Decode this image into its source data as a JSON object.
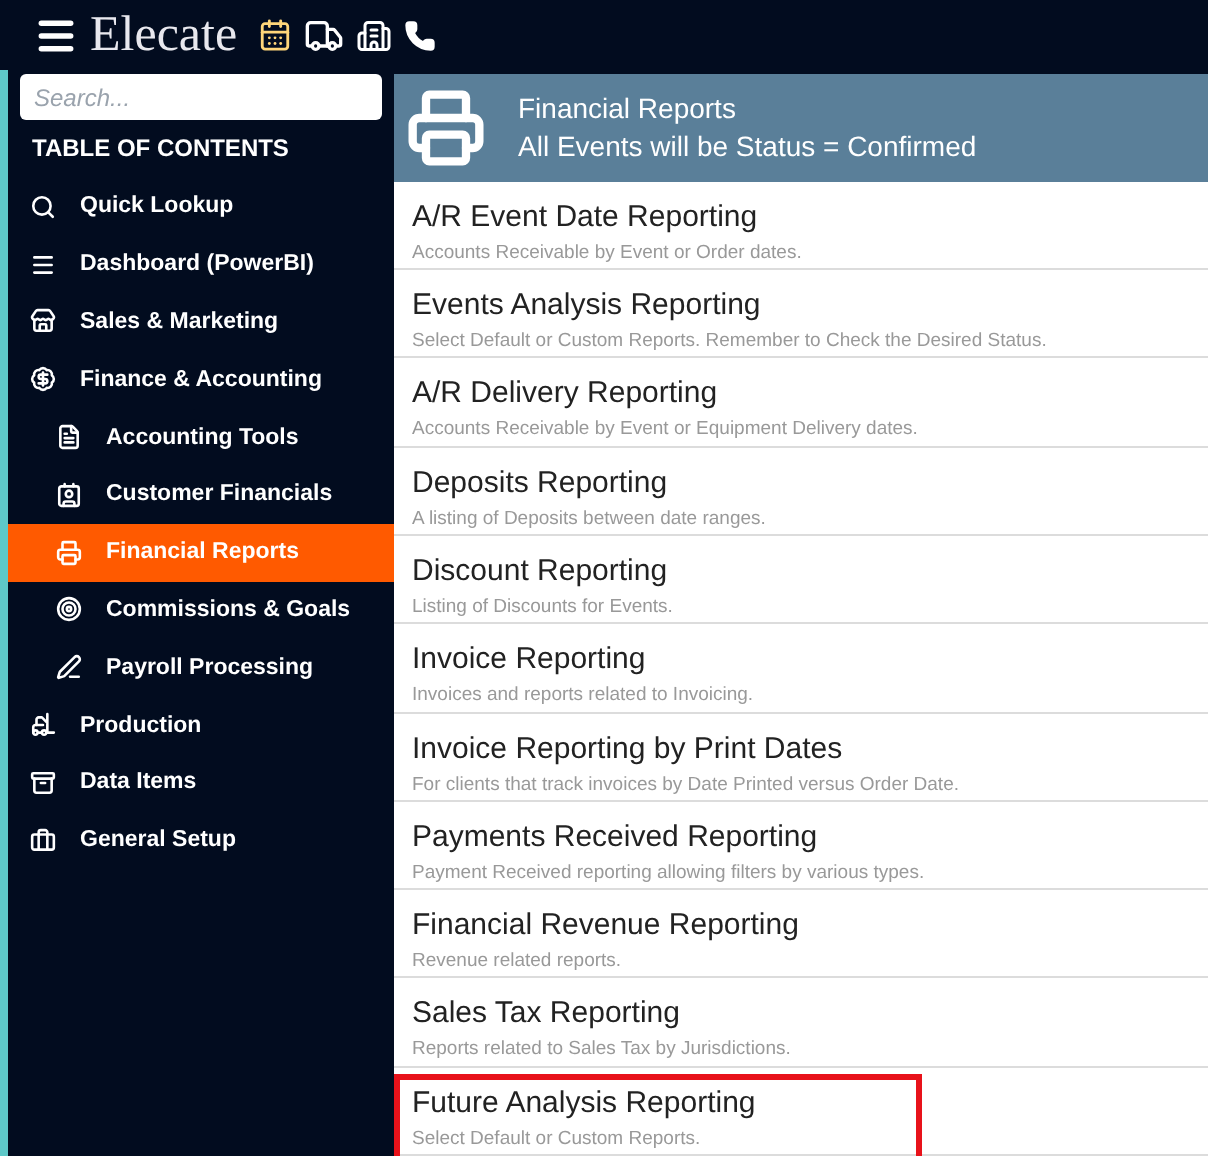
{
  "topbar": {
    "brand": "Elecate"
  },
  "sidebar": {
    "search": {
      "placeholder": "Search..."
    },
    "heading": "TABLE OF CONTENTS",
    "items": [
      {
        "label": "Quick Lookup",
        "selected": false
      },
      {
        "label": "Dashboard (PowerBI)",
        "selected": false
      },
      {
        "label": "Sales & Marketing",
        "selected": false
      },
      {
        "label": "Finance & Accounting",
        "selected": false,
        "children": [
          {
            "label": "Accounting Tools",
            "selected": false
          },
          {
            "label": "Customer Financials",
            "selected": false
          },
          {
            "label": "Financial Reports",
            "selected": true
          },
          {
            "label": "Commissions & Goals",
            "selected": false
          },
          {
            "label": "Payroll Processing",
            "selected": false
          }
        ]
      },
      {
        "label": "Production",
        "selected": false
      },
      {
        "label": "Data Items",
        "selected": false
      },
      {
        "label": "General Setup",
        "selected": false
      }
    ]
  },
  "header": {
    "title": "Financial Reports",
    "subtitle": "All Events will be Status = Confirmed"
  },
  "reports": [
    {
      "title": "A/R Event Date Reporting",
      "description": "Accounts Receivable by Event or Order dates.",
      "highlighted": false
    },
    {
      "title": "Events Analysis Reporting",
      "description": "Select Default or Custom Reports. Remember to Check the Desired Status.",
      "highlighted": false
    },
    {
      "title": "A/R Delivery Reporting",
      "description": "Accounts Receivable by Event or Equipment Delivery dates.",
      "highlighted": false
    },
    {
      "title": "Deposits Reporting",
      "description": "A listing of Deposits between date ranges.",
      "highlighted": false
    },
    {
      "title": "Discount Reporting",
      "description": "Listing of Discounts for Events.",
      "highlighted": false
    },
    {
      "title": "Invoice Reporting",
      "description": "Invoices and reports related to Invoicing.",
      "highlighted": false
    },
    {
      "title": "Invoice Reporting by Print Dates",
      "description": "For clients that track invoices by Date Printed versus Order Date.",
      "highlighted": false
    },
    {
      "title": "Payments Received Reporting",
      "description": "Payment Received reporting allowing filters by various types.",
      "highlighted": false
    },
    {
      "title": "Financial Revenue Reporting",
      "description": "Revenue related reports.",
      "highlighted": false
    },
    {
      "title": "Sales Tax Reporting",
      "description": "Reports related to Sales Tax by Jurisdictions.",
      "highlighted": false
    },
    {
      "title": "Future Analysis Reporting",
      "description": "Select Default or Custom Reports.",
      "highlighted": true
    }
  ]
}
